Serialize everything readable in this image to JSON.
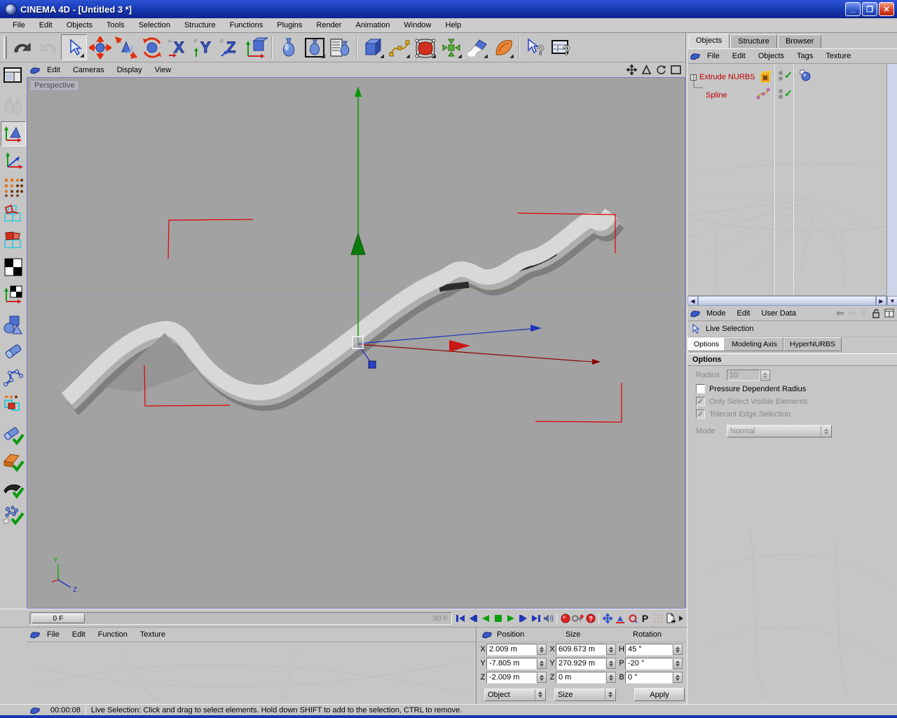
{
  "window": {
    "title": "CINEMA 4D - [Untitled 3 *]",
    "controls": {
      "minimize": "_",
      "restore": "❐",
      "close": "✕"
    }
  },
  "menubar": {
    "items": [
      "File",
      "Edit",
      "Objects",
      "Tools",
      "Selection",
      "Structure",
      "Functions",
      "Plugins",
      "Render",
      "Animation",
      "Window",
      "Help"
    ]
  },
  "viewport": {
    "menu": [
      "Edit",
      "Cameras",
      "Display",
      "View"
    ],
    "camera_label": "Perspective",
    "axis_labels": {
      "y": "Y",
      "z": "Z"
    }
  },
  "object_manager": {
    "tabs": [
      "Objects",
      "Structure",
      "Browser"
    ],
    "active_tab": "Objects",
    "menu": [
      "File",
      "Edit",
      "Objects",
      "Tags",
      "Texture"
    ],
    "objects": [
      {
        "name": "Extrude NURBS",
        "expanded": "-",
        "enabled_check": "✓"
      },
      {
        "name": "Spline",
        "enabled_check": "✓"
      }
    ]
  },
  "attribute_manager": {
    "menu": [
      "Mode",
      "Edit",
      "User Data"
    ],
    "nav": {
      "back": "⇦",
      "forward": "⇨",
      "up": "⇧"
    },
    "tool_label": "Live Selection",
    "tabs": [
      "Options",
      "Modeling Axis",
      "HyperNURBS"
    ],
    "active_tab": "Options",
    "section_title": "Options",
    "radius": {
      "label": "Radius",
      "value": "10"
    },
    "checkboxes": [
      {
        "label": "Pressure Dependent Radius",
        "checked": false,
        "enabled": true
      },
      {
        "label": "Only Select Visible Elements",
        "checked": true,
        "enabled": false
      },
      {
        "label": "Tolerant Edge Selection",
        "checked": true,
        "enabled": false
      }
    ],
    "mode": {
      "label": "Mode",
      "value": "Normal"
    }
  },
  "timeline": {
    "current_frame": "0 F",
    "end_frame": "90 F",
    "record_param_label": "P"
  },
  "materials_manager": {
    "menu": [
      "File",
      "Edit",
      "Function",
      "Texture"
    ]
  },
  "coordinates": {
    "headers": {
      "position": "Position",
      "size": "Size",
      "rotation": "Rotation"
    },
    "rows": [
      {
        "p_label": "X",
        "p": "2.009 m",
        "s_label": "X",
        "s": "609.673 m",
        "r_label": "H",
        "r": "45 °"
      },
      {
        "p_label": "Y",
        "p": "-7.805 m",
        "s_label": "Y",
        "s": "270.929 m",
        "r_label": "P",
        "r": "-20 °"
      },
      {
        "p_label": "Z",
        "p": "-2.009 m",
        "s_label": "Z",
        "s": "0 m",
        "r_label": "B",
        "r": "0 °"
      }
    ],
    "mode_dropdown": "Object",
    "size_dropdown": "Size",
    "apply_label": "Apply"
  },
  "statusbar": {
    "time": "00:00:08",
    "message": "Live Selection: Click and drag to select elements. Hold down SHIFT to add to the selection, CTRL to remove."
  },
  "icons": {
    "check": "✓",
    "minus": "-"
  },
  "colors": {
    "object_text_red": "#c00000",
    "check_green": "#00a000",
    "viewport_bg": "#a2a2a2",
    "titlebar_blue": "#1736ae",
    "axis_green": "#009900",
    "axis_red": "#cc1515",
    "axis_blue": "#2233bb"
  }
}
